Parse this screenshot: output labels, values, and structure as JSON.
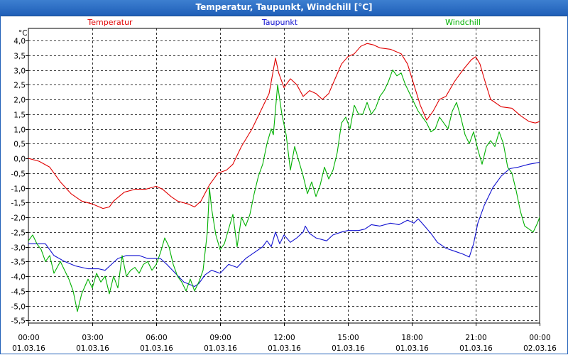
{
  "window": {
    "title": "Temperatur, Taupunkt, Windchill [°C]"
  },
  "chart_data": {
    "type": "line",
    "title": "Temperatur, Taupunkt, Windchill [°C]",
    "ylabel": "°C",
    "ylim": [
      -5.5,
      4.0
    ],
    "yticks": [
      "4,0",
      "3,5",
      "3,0",
      "2,5",
      "2,0",
      "1,5",
      "1,0",
      "0,5",
      "0,0",
      "-0,5",
      "-1,0",
      "-1,5",
      "-2,0",
      "-2,5",
      "-3,0",
      "-3,5",
      "-4,0",
      "-4,5",
      "-5,0",
      "-5,5"
    ],
    "xlim": [
      0,
      24
    ],
    "xticks": [
      {
        "time": "00:00",
        "date": "01.03.16"
      },
      {
        "time": "03:00",
        "date": "01.03.16"
      },
      {
        "time": "06:00",
        "date": "01.03.16"
      },
      {
        "time": "09:00",
        "date": "01.03.16"
      },
      {
        "time": "12:00",
        "date": "01.03.16"
      },
      {
        "time": "15:00",
        "date": "01.03.16"
      },
      {
        "time": "18:00",
        "date": "01.03.16"
      },
      {
        "time": "21:00",
        "date": "01.03.16"
      },
      {
        "time": "00:00",
        "date": "02.03.16"
      }
    ],
    "grid": true,
    "legend_position": "top",
    "series": [
      {
        "name": "Temperatur",
        "color": "#e00000",
        "points": [
          [
            0,
            0
          ],
          [
            0.5,
            -0.1
          ],
          [
            1,
            -0.3
          ],
          [
            1.5,
            -0.8
          ],
          [
            2,
            -1.2
          ],
          [
            2.5,
            -1.45
          ],
          [
            3,
            -1.55
          ],
          [
            3.5,
            -1.7
          ],
          [
            3.8,
            -1.65
          ],
          [
            4,
            -1.45
          ],
          [
            4.5,
            -1.15
          ],
          [
            5,
            -1.05
          ],
          [
            5.5,
            -1.05
          ],
          [
            6,
            -0.95
          ],
          [
            6.3,
            -1.05
          ],
          [
            6.7,
            -1.3
          ],
          [
            7,
            -1.45
          ],
          [
            7.5,
            -1.55
          ],
          [
            7.8,
            -1.65
          ],
          [
            8.1,
            -1.45
          ],
          [
            8.5,
            -0.9
          ],
          [
            8.9,
            -0.5
          ],
          [
            9.3,
            -0.4
          ],
          [
            9.6,
            -0.2
          ],
          [
            10,
            0.4
          ],
          [
            10.5,
            1.0
          ],
          [
            10.9,
            1.6
          ],
          [
            11.3,
            2.2
          ],
          [
            11.5,
            3.0
          ],
          [
            11.6,
            3.4
          ],
          [
            11.75,
            2.9
          ],
          [
            12,
            2.4
          ],
          [
            12.3,
            2.7
          ],
          [
            12.6,
            2.5
          ],
          [
            12.9,
            2.1
          ],
          [
            13.2,
            2.3
          ],
          [
            13.5,
            2.2
          ],
          [
            13.8,
            2.0
          ],
          [
            14.1,
            2.2
          ],
          [
            14.4,
            2.7
          ],
          [
            14.7,
            3.2
          ],
          [
            15,
            3.45
          ],
          [
            15.3,
            3.55
          ],
          [
            15.6,
            3.8
          ],
          [
            15.9,
            3.9
          ],
          [
            16.2,
            3.85
          ],
          [
            16.5,
            3.75
          ],
          [
            17,
            3.7
          ],
          [
            17.5,
            3.55
          ],
          [
            17.8,
            3.2
          ],
          [
            18.1,
            2.5
          ],
          [
            18.4,
            1.8
          ],
          [
            18.7,
            1.3
          ],
          [
            19,
            1.6
          ],
          [
            19.3,
            2.0
          ],
          [
            19.6,
            2.1
          ],
          [
            20,
            2.6
          ],
          [
            20.4,
            3.0
          ],
          [
            20.8,
            3.35
          ],
          [
            21,
            3.45
          ],
          [
            21.2,
            3.2
          ],
          [
            21.4,
            2.7
          ],
          [
            21.7,
            2.0
          ],
          [
            22.2,
            1.75
          ],
          [
            22.7,
            1.7
          ],
          [
            23.1,
            1.45
          ],
          [
            23.5,
            1.25
          ],
          [
            23.8,
            1.2
          ],
          [
            24.2,
            1.3
          ],
          [
            24.6,
            1.5
          ]
        ]
      },
      {
        "name": "Taupunkt",
        "color": "#1010d0",
        "points": [
          [
            0,
            -2.9
          ],
          [
            0.8,
            -2.9
          ],
          [
            1.2,
            -3.3
          ],
          [
            1.7,
            -3.5
          ],
          [
            2.2,
            -3.65
          ],
          [
            2.8,
            -3.75
          ],
          [
            3.3,
            -3.75
          ],
          [
            3.6,
            -3.8
          ],
          [
            3.9,
            -3.6
          ],
          [
            4.2,
            -3.4
          ],
          [
            4.6,
            -3.3
          ],
          [
            5.2,
            -3.3
          ],
          [
            5.6,
            -3.4
          ],
          [
            6.2,
            -3.4
          ],
          [
            6.5,
            -3.6
          ],
          [
            6.9,
            -3.9
          ],
          [
            7.3,
            -4.2
          ],
          [
            7.8,
            -4.35
          ],
          [
            8.0,
            -4.25
          ],
          [
            8.3,
            -3.95
          ],
          [
            8.6,
            -3.8
          ],
          [
            9.0,
            -3.9
          ],
          [
            9.4,
            -3.6
          ],
          [
            9.8,
            -3.7
          ],
          [
            10.2,
            -3.4
          ],
          [
            10.6,
            -3.2
          ],
          [
            11.0,
            -3.0
          ],
          [
            11.2,
            -2.8
          ],
          [
            11.4,
            -3.0
          ],
          [
            11.6,
            -2.5
          ],
          [
            11.8,
            -2.9
          ],
          [
            12.0,
            -2.6
          ],
          [
            12.3,
            -2.85
          ],
          [
            12.6,
            -2.7
          ],
          [
            12.9,
            -2.5
          ],
          [
            13.0,
            -2.3
          ],
          [
            13.2,
            -2.55
          ],
          [
            13.5,
            -2.7
          ],
          [
            14.0,
            -2.8
          ],
          [
            14.3,
            -2.6
          ],
          [
            14.7,
            -2.5
          ],
          [
            15.0,
            -2.45
          ],
          [
            15.5,
            -2.45
          ],
          [
            15.8,
            -2.4
          ],
          [
            16.1,
            -2.25
          ],
          [
            16.5,
            -2.3
          ],
          [
            17.0,
            -2.2
          ],
          [
            17.4,
            -2.25
          ],
          [
            17.8,
            -2.1
          ],
          [
            18.1,
            -2.2
          ],
          [
            18.3,
            -2.05
          ],
          [
            18.6,
            -2.3
          ],
          [
            18.9,
            -2.55
          ],
          [
            19.2,
            -2.85
          ],
          [
            19.6,
            -3.05
          ],
          [
            20.0,
            -3.15
          ],
          [
            20.4,
            -3.25
          ],
          [
            20.7,
            -3.35
          ],
          [
            20.9,
            -2.9
          ],
          [
            21.1,
            -2.2
          ],
          [
            21.4,
            -1.6
          ],
          [
            21.8,
            -1.0
          ],
          [
            22.2,
            -0.6
          ],
          [
            22.6,
            -0.35
          ],
          [
            23.0,
            -0.3
          ],
          [
            23.5,
            -0.2
          ],
          [
            23.9,
            -0.15
          ],
          [
            24.2,
            -0.1
          ],
          [
            24.5,
            -0.1
          ]
        ]
      },
      {
        "name": "Windchill",
        "color": "#00b000",
        "points": [
          [
            0,
            -2.8
          ],
          [
            0.2,
            -2.6
          ],
          [
            0.4,
            -2.9
          ],
          [
            0.6,
            -3.1
          ],
          [
            0.8,
            -3.5
          ],
          [
            1.0,
            -3.3
          ],
          [
            1.2,
            -3.9
          ],
          [
            1.5,
            -3.5
          ],
          [
            1.7,
            -3.8
          ],
          [
            1.9,
            -4.1
          ],
          [
            2.1,
            -4.5
          ],
          [
            2.3,
            -5.2
          ],
          [
            2.5,
            -4.6
          ],
          [
            2.8,
            -4.1
          ],
          [
            3.0,
            -4.4
          ],
          [
            3.2,
            -3.9
          ],
          [
            3.4,
            -4.2
          ],
          [
            3.6,
            -4.0
          ],
          [
            3.8,
            -4.6
          ],
          [
            4.0,
            -4.0
          ],
          [
            4.2,
            -4.4
          ],
          [
            4.4,
            -3.3
          ],
          [
            4.6,
            -4.0
          ],
          [
            4.8,
            -3.8
          ],
          [
            5.0,
            -3.7
          ],
          [
            5.2,
            -3.9
          ],
          [
            5.4,
            -3.6
          ],
          [
            5.6,
            -3.5
          ],
          [
            5.8,
            -3.8
          ],
          [
            6.0,
            -3.6
          ],
          [
            6.2,
            -3.2
          ],
          [
            6.4,
            -2.7
          ],
          [
            6.6,
            -3.0
          ],
          [
            6.8,
            -3.6
          ],
          [
            7.0,
            -4.0
          ],
          [
            7.2,
            -4.2
          ],
          [
            7.4,
            -4.5
          ],
          [
            7.6,
            -4.1
          ],
          [
            7.8,
            -4.5
          ],
          [
            8.0,
            -4.2
          ],
          [
            8.2,
            -3.8
          ],
          [
            8.4,
            -2.5
          ],
          [
            8.5,
            -1.0
          ],
          [
            8.6,
            -1.7
          ],
          [
            8.8,
            -2.6
          ],
          [
            9.0,
            -3.1
          ],
          [
            9.2,
            -2.9
          ],
          [
            9.4,
            -2.4
          ],
          [
            9.6,
            -1.9
          ],
          [
            9.8,
            -3.0
          ],
          [
            10.0,
            -2.0
          ],
          [
            10.2,
            -2.3
          ],
          [
            10.4,
            -1.9
          ],
          [
            10.6,
            -1.2
          ],
          [
            10.8,
            -0.6
          ],
          [
            11.0,
            -0.2
          ],
          [
            11.2,
            0.5
          ],
          [
            11.4,
            1.0
          ],
          [
            11.5,
            0.8
          ],
          [
            11.7,
            2.5
          ],
          [
            11.9,
            1.5
          ],
          [
            12.1,
            0.8
          ],
          [
            12.3,
            -0.4
          ],
          [
            12.5,
            0.4
          ],
          [
            12.7,
            -0.1
          ],
          [
            12.9,
            -0.6
          ],
          [
            13.1,
            -1.2
          ],
          [
            13.3,
            -0.8
          ],
          [
            13.5,
            -1.3
          ],
          [
            13.7,
            -0.9
          ],
          [
            13.9,
            -0.3
          ],
          [
            14.1,
            -0.7
          ],
          [
            14.3,
            -0.4
          ],
          [
            14.5,
            0.2
          ],
          [
            14.7,
            1.2
          ],
          [
            14.9,
            1.4
          ],
          [
            15.1,
            1.0
          ],
          [
            15.3,
            1.8
          ],
          [
            15.5,
            1.5
          ],
          [
            15.7,
            1.5
          ],
          [
            15.9,
            1.9
          ],
          [
            16.1,
            1.5
          ],
          [
            16.3,
            1.7
          ],
          [
            16.5,
            2.1
          ],
          [
            16.7,
            2.3
          ],
          [
            16.9,
            2.6
          ],
          [
            17.1,
            3.0
          ],
          [
            17.3,
            2.8
          ],
          [
            17.5,
            2.9
          ],
          [
            17.7,
            2.5
          ],
          [
            17.9,
            2.2
          ],
          [
            18.1,
            1.9
          ],
          [
            18.3,
            1.6
          ],
          [
            18.5,
            1.4
          ],
          [
            18.7,
            1.2
          ],
          [
            18.9,
            0.9
          ],
          [
            19.1,
            1.0
          ],
          [
            19.3,
            1.4
          ],
          [
            19.5,
            1.2
          ],
          [
            19.7,
            1.0
          ],
          [
            19.9,
            1.6
          ],
          [
            20.1,
            1.9
          ],
          [
            20.3,
            1.4
          ],
          [
            20.5,
            0.8
          ],
          [
            20.7,
            0.5
          ],
          [
            20.9,
            0.9
          ],
          [
            21.1,
            0.3
          ],
          [
            21.3,
            -0.2
          ],
          [
            21.5,
            0.4
          ],
          [
            21.7,
            0.6
          ],
          [
            21.9,
            0.4
          ],
          [
            22.1,
            0.9
          ],
          [
            22.3,
            0.5
          ],
          [
            22.5,
            -0.3
          ],
          [
            22.7,
            -0.5
          ],
          [
            22.9,
            -1.1
          ],
          [
            23.1,
            -1.8
          ],
          [
            23.3,
            -2.3
          ],
          [
            23.5,
            -2.4
          ],
          [
            23.7,
            -2.5
          ],
          [
            23.9,
            -2.2
          ],
          [
            24.1,
            -1.8
          ],
          [
            24.3,
            -1.7
          ],
          [
            24.5,
            -2.4
          ],
          [
            24.7,
            -2.5
          ],
          [
            24.9,
            -2.5
          ]
        ]
      }
    ]
  }
}
